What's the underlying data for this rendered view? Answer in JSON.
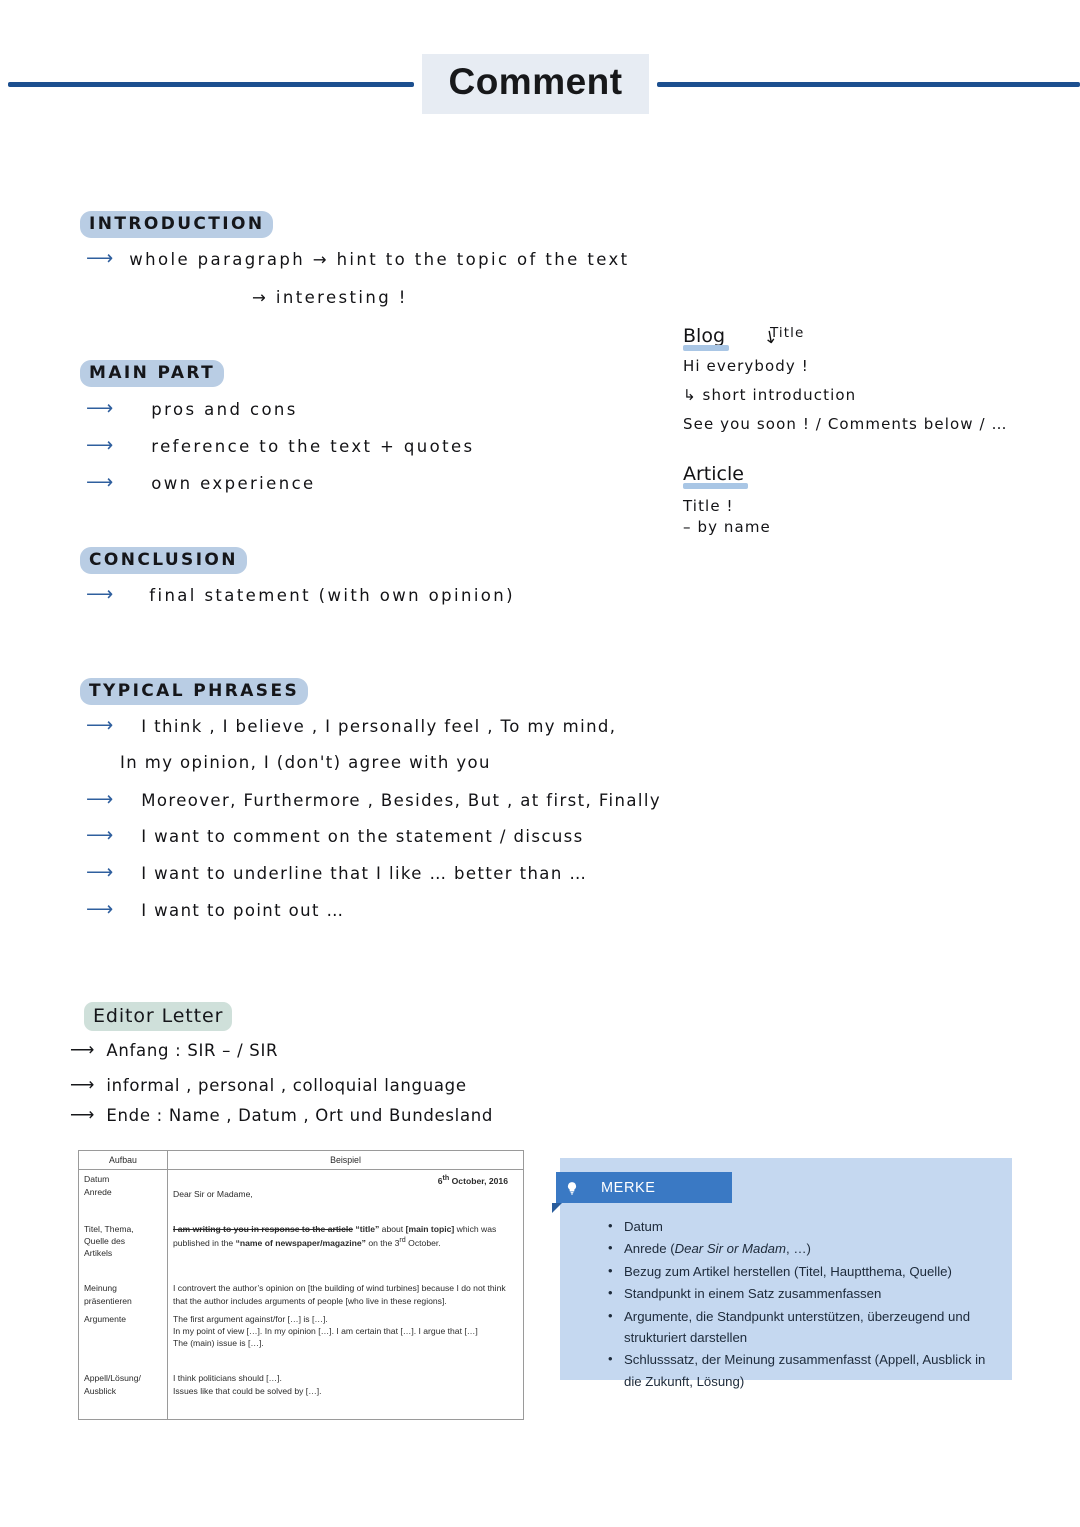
{
  "header": {
    "title": "Comment",
    "rule_color": "#1c4f8f",
    "title_box_color": "#e7ecf3"
  },
  "sections": [
    {
      "heading": "INTRODUCTION",
      "lines": [
        "whole  paragraph  →  hint to the  topic  of  the  text",
        "→  interesting  !"
      ]
    },
    {
      "heading": "MAIN  PART",
      "lines": [
        "pros  and  cons",
        "reference  to  the  text  +  quotes",
        "own  experience"
      ]
    },
    {
      "heading": "CONCLUSION",
      "lines": [
        "final  statement     (with  own  opinion)"
      ]
    },
    {
      "heading": "TYPICAL   PHRASES",
      "lines": [
        "I  think ,  I  believe ,  I  personally  feel , To my  mind,",
        "In  my  opinion,  I  (don't)  agree  with  you",
        "Moreover,  Furthermore ,  Besides,  But ,  at  first,  Finally",
        "I  want  to  comment  on  the  statement  /  discuss",
        "I  want  to  underline  that  I  like … better than …",
        "I  want  to  point  out …"
      ]
    }
  ],
  "editor_letter": {
    "heading": "Editor  Letter",
    "lines": [
      "Anfang :     SIR – / SIR",
      "informal , personal , colloquial   language",
      "Ende :    Name , Datum ,  Ort und Bundesland"
    ]
  },
  "notes": {
    "blog": {
      "heading": "Blog",
      "title_label": "Title",
      "lines": [
        "Hi  everybody !",
        "↳ short  introduction",
        "See  you  soon ! / Comments  below / …"
      ]
    },
    "article": {
      "heading": "Article",
      "lines": [
        "Title  !",
        "– by  name"
      ]
    }
  },
  "table": {
    "headers": [
      "Aufbau",
      "Beispiel"
    ],
    "rows": [
      {
        "label": [
          "Datum",
          "Anrede"
        ],
        "date": "6th October, 2016",
        "body": [
          "Dear Sir or Madame,"
        ]
      },
      {
        "label": [
          "Titel, Thema,",
          "Quelle des",
          "Artikels"
        ],
        "body_strike": "I am writing to you in response to the article ",
        "body": [
          "“title” about [main topic] which was published in the “name of newspaper/magazine” on the 3rd October."
        ]
      },
      {
        "label": [
          "Meinung",
          "präsentieren"
        ],
        "body": [
          "I controvert the author’s opinion on [the building of wind turbines] because I do not think that the author includes arguments of people [who live in these regions]."
        ]
      },
      {
        "label": [
          "Argumente"
        ],
        "body": [
          "The first argument against/for […] is […].",
          "In my point of view […]. In my opinion […]. I am certain that […]. I argue that […]",
          "The (main) issue is […]."
        ]
      },
      {
        "label": [
          "Appell/Lösung/",
          "Ausblick"
        ],
        "body": [
          "I think politicians should […].",
          "Issues like that could be solved by […]."
        ]
      }
    ]
  },
  "merke": {
    "title": "MERKE",
    "icon": "lightbulb-icon",
    "header_color": "#3a79c4",
    "panel_color": "#c5d8f0",
    "items": [
      "Datum",
      "Anrede (Dear Sir or Madam, …)",
      "Bezug zum Artikel herstellen (Titel, Hauptthema, Quelle)",
      "Standpunkt in einem Satz zusammenfassen",
      "Argumente, die Standpunkt unterstützen, überzeugend und strukturiert darstellen",
      "Schlusssatz, der Meinung zusammenfasst (Appell, Ausblick in die Zukunft, Lösung)"
    ]
  }
}
